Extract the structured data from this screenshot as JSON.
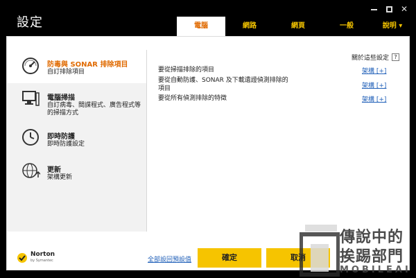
{
  "window": {
    "title": "設定",
    "controls": [
      "minimize",
      "maximize",
      "close"
    ]
  },
  "tabs": [
    {
      "label": "電腦",
      "active": true
    },
    {
      "label": "網路",
      "active": false
    },
    {
      "label": "網頁",
      "active": false
    },
    {
      "label": "一般",
      "active": false
    },
    {
      "label": "說明 ▾",
      "active": false
    }
  ],
  "sidebar": {
    "items": [
      {
        "title": "防毒與 SONAR 排除項目",
        "sub": "自訂排除項目",
        "icon": "gauge-icon",
        "active": true
      },
      {
        "title": "電腦掃描",
        "sub": "自訂病毒、間諜程式、廣告程式等的掃描方式",
        "icon": "computer-icon",
        "active": false
      },
      {
        "title": "即時防護",
        "sub": "即時防護設定",
        "icon": "clock-icon",
        "active": false
      },
      {
        "title": "更新",
        "sub": "架構更新",
        "icon": "globe-update-icon",
        "active": false
      }
    ]
  },
  "content": {
    "about_label": "關於這些設定",
    "help_label": "?",
    "rows": [
      {
        "text": "要從掃描排除的項目",
        "link": "架構 [+]"
      },
      {
        "text": "要從自動防護、SONAR 及下載遺證偵測排除的項目",
        "link": "架構 [+]"
      },
      {
        "text": "要從所有偵測排除的特徵",
        "link": "架構 [+]"
      }
    ]
  },
  "footer": {
    "brand": "Norton",
    "brand_sub": "by Symantec",
    "reset_link": "全部設回預設值",
    "ok_label": "確定",
    "cancel_label": "取消"
  },
  "watermark": {
    "line1": "傳說中的",
    "line2": "挨踢部門",
    "line3": "MOBILEAI"
  },
  "colors": {
    "accent_orange": "#e06a00",
    "tab_yellow": "#f2c200",
    "button_yellow": "#f6c400",
    "link_blue": "#1f5fb8"
  }
}
